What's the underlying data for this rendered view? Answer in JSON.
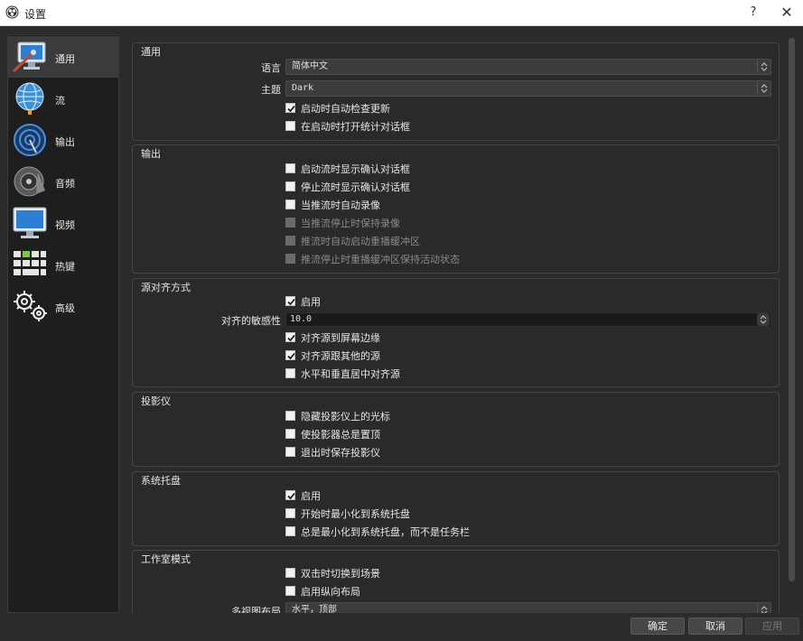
{
  "window": {
    "title": "设置",
    "help": "?",
    "close": "✕"
  },
  "sidebar": {
    "items": [
      {
        "label": "通用",
        "icon": "general-monitor-icon",
        "active": true
      },
      {
        "label": "流",
        "icon": "stream-globe-icon"
      },
      {
        "label": "输出",
        "icon": "output-antenna-icon"
      },
      {
        "label": "音频",
        "icon": "audio-speaker-icon"
      },
      {
        "label": "视频",
        "icon": "video-monitor-icon"
      },
      {
        "label": "热键",
        "icon": "hotkeys-keyboard-icon"
      },
      {
        "label": "高级",
        "icon": "advanced-gears-icon"
      }
    ]
  },
  "general": {
    "title": "通用",
    "language_label": "语言",
    "language_value": "简体中文",
    "theme_label": "主题",
    "theme_value": "Dark",
    "checks": [
      {
        "label": "启动时自动检查更新",
        "checked": true
      },
      {
        "label": "在启动时打开统计对话框",
        "checked": false
      }
    ]
  },
  "output": {
    "title": "输出",
    "checks": [
      {
        "label": "启动流时显示确认对话框",
        "checked": false
      },
      {
        "label": "停止流时显示确认对话框",
        "checked": false
      },
      {
        "label": "当推流时自动录像",
        "checked": false
      },
      {
        "label": "当推流停止时保持录像",
        "checked": false,
        "disabled": true
      },
      {
        "label": "推流时自动启动重播缓冲区",
        "checked": false,
        "disabled": true
      },
      {
        "label": "推流停止时重播缓冲区保持活动状态",
        "checked": false,
        "disabled": true
      }
    ]
  },
  "snapping": {
    "title": "源对齐方式",
    "enable": {
      "label": "启用",
      "checked": true
    },
    "sensitivity_label": "对齐的敏感性",
    "sensitivity_value": "10.0",
    "checks": [
      {
        "label": "对齐源到屏幕边缘",
        "checked": true
      },
      {
        "label": "对齐源跟其他的源",
        "checked": true
      },
      {
        "label": "水平和垂直居中对齐源",
        "checked": false
      }
    ]
  },
  "projectors": {
    "title": "投影仪",
    "checks": [
      {
        "label": "隐藏投影仪上的光标",
        "checked": false
      },
      {
        "label": "使投影器总是置顶",
        "checked": false
      },
      {
        "label": "退出时保存投影仪",
        "checked": false
      }
    ]
  },
  "tray": {
    "title": "系统托盘",
    "checks": [
      {
        "label": "启用",
        "checked": true
      },
      {
        "label": "开始时最小化到系统托盘",
        "checked": false
      },
      {
        "label": "总是最小化到系统托盘，而不是任务栏",
        "checked": false
      }
    ]
  },
  "studio": {
    "title": "工作室模式",
    "checks": [
      {
        "label": "双击时切换到场景",
        "checked": false
      },
      {
        "label": "启用纵向布局",
        "checked": false
      }
    ],
    "multiview_label": "多视图布局",
    "multiview_value": "水平，顶部"
  },
  "buttons": {
    "ok": "确定",
    "cancel": "取消",
    "apply": "应用"
  }
}
